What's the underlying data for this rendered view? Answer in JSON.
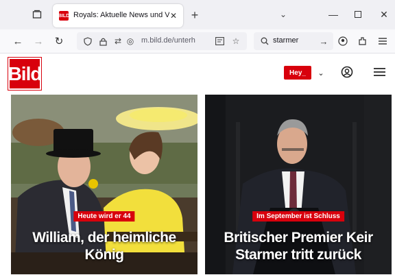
{
  "browser": {
    "tab": {
      "favicon_text": "BILD",
      "title": "Royals: Aktuelle News und Vide"
    },
    "url": "m.bild.de/unterh",
    "search": {
      "value": "starmer"
    }
  },
  "site": {
    "logo_text": "Bild",
    "hey_label": "Hey_",
    "brand_color": "#d8000c"
  },
  "articles": [
    {
      "kicker": "Heute wird er 44",
      "headline_line1": "William, der heimliche",
      "headline_line2": "König"
    },
    {
      "kicker": "Im September ist Schluss",
      "headline_line1": "Britischer Premier Keir",
      "headline_line2": "Starmer tritt zurück"
    }
  ]
}
